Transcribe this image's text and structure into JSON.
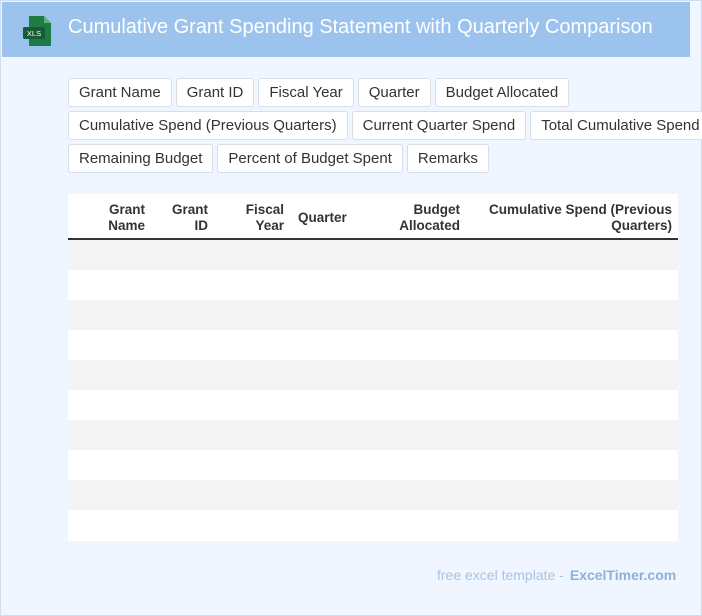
{
  "header": {
    "icon_label": "XLS",
    "title": "Cumulative Grant Spending Statement with Quarterly Comparison",
    "icon_color": "#1e7b45"
  },
  "fields": [
    [
      "Grant Name",
      "Grant ID",
      "Fiscal Year",
      "Quarter",
      "Budget Allocated"
    ],
    [
      "Cumulative Spend (Previous Quarters)",
      "Current Quarter Spend",
      "Total Cumulative Spend"
    ],
    [
      "Remaining Budget",
      "Percent of Budget Spent",
      "Remarks"
    ]
  ],
  "table": {
    "headers": [
      {
        "line1": "Grant",
        "line2": "Name"
      },
      {
        "line1": "Grant",
        "line2": "ID"
      },
      {
        "line1": "Fiscal",
        "line2": "Year"
      },
      {
        "line1": "Quarter",
        "line2": ""
      },
      {
        "line1": "Budget",
        "line2": "Allocated"
      },
      {
        "line1": "Cumulative Spend (Previous",
        "line2": "Quarters)"
      }
    ],
    "row_count": 10
  },
  "footer": {
    "text": "free excel template -",
    "brand": "ExcelTimer.com"
  },
  "colors": {
    "header_bg": "#9cc3ee",
    "row_stripe": "#f4f4f4",
    "footer_text": "#a9c2df"
  }
}
